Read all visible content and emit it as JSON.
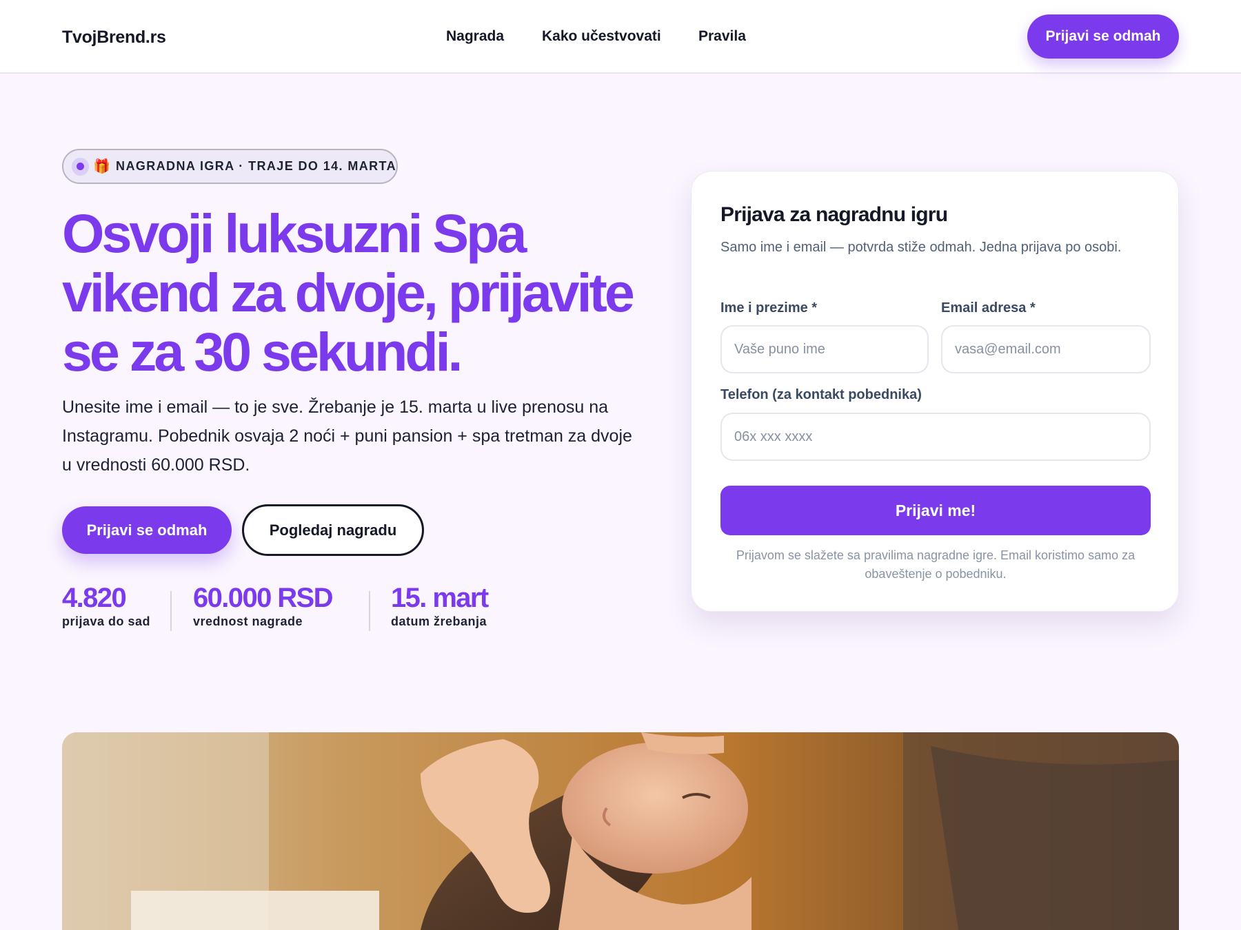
{
  "header": {
    "brand": "TvojBrend.rs",
    "nav": [
      "Nagrada",
      "Kako učestvovati",
      "Pravila"
    ],
    "cta": "Prijavi se odmah"
  },
  "hero": {
    "badge_icon": "gift-icon",
    "badge": "NAGRADNA IGRA · TRAJE DO 14. MARTA",
    "headline": "Osvoji luksuzni Spa vikend za dvoje, prijavite se za 30 sekundi.",
    "lead": "Unesite ime i email — to je sve. Žrebanje je 15. marta u live prenosu na Instagramu. Pobednik osvaja 2 noći + puni pansion + spa tretman za dvoje u vrednosti 60.000 RSD.",
    "primary_button": "Prijavi se odmah",
    "secondary_button": "Pogledaj nagradu",
    "stats": [
      {
        "value": "4.820",
        "label": "prijava do sad"
      },
      {
        "value": "60.000 RSD",
        "label": "vrednost nagrade"
      },
      {
        "value": "15. mart",
        "label": "datum žrebanja"
      }
    ]
  },
  "form": {
    "title": "Prijava za nagradnu igru",
    "subtitle": "Samo ime i email — potvrda stiže odmah. Jedna prijava po osobi.",
    "name_label": "Ime i prezime *",
    "name_placeholder": "Vaše puno ime",
    "email_label": "Email adresa *",
    "email_placeholder": "vasa@email.com",
    "phone_label": "Telefon (za kontakt pobednika)",
    "phone_placeholder": "06x xxx xxxx",
    "submit": "Prijavi me!",
    "disclaimer": "Prijavom se slažete sa pravilima nagradne igre. Email koristimo samo za obaveštenje o pobedniku."
  },
  "colors": {
    "accent": "#7c3aed",
    "background": "#faf5fe",
    "text": "#141827"
  }
}
